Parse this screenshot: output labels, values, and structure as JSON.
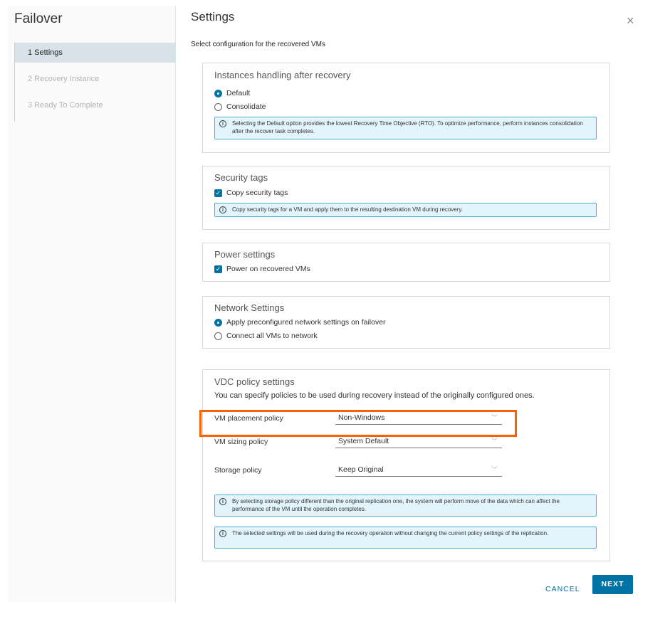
{
  "wizard": {
    "title": "Failover",
    "steps": [
      {
        "label": "1  Settings"
      },
      {
        "label": "2  Recovery Instance"
      },
      {
        "label": "3  Ready To Complete"
      }
    ]
  },
  "page": {
    "title": "Settings",
    "close_icon": "×",
    "subtitle": "Select configuration for the recovered VMs"
  },
  "instances": {
    "title": "Instances handling after recovery",
    "options": [
      {
        "label": "Default",
        "selected": true
      },
      {
        "label": "Consolidate",
        "selected": false
      }
    ],
    "info": "Selecting the Default option provides the lowest Recovery Time Objective (RTO). To optimize performance, perform instances consolidation after the recover task completes."
  },
  "security": {
    "title": "Security tags",
    "checkbox_label": "Copy security tags",
    "checked": true,
    "info": "Copy security tags for a VM and apply them to the resulting destination VM during recovery."
  },
  "power": {
    "title": "Power settings",
    "checkbox_label": "Power on recovered VMs",
    "checked": true
  },
  "network": {
    "title": "Network Settings",
    "options": [
      {
        "label": "Apply preconfigured network settings on failover",
        "selected": true
      },
      {
        "label": "Connect all VMs to network",
        "selected": false
      }
    ]
  },
  "vdc": {
    "title": "VDC policy settings",
    "description": "You can specify policies to be used during recovery instead of the originally configured ones.",
    "placement": {
      "label": "VM placement policy",
      "value": "Non-Windows"
    },
    "sizing": {
      "label": "VM sizing policy",
      "value": "System Default"
    },
    "storage": {
      "label": "Storage policy",
      "value": "Keep Original"
    },
    "info1": "By selecting storage policy different than the original replication one, the system will perform move of the data which can affect the performance of the VM until the operation completes.",
    "info2": "The selected settings will be used during the recovery operation without changing the current policy settings of the replication."
  },
  "footer": {
    "cancel_label": "CANCEL",
    "next_label": "NEXT"
  },
  "colors": {
    "accent": "#0072a3",
    "highlight": "#ff6100",
    "info_bg": "#e3f5fc"
  }
}
